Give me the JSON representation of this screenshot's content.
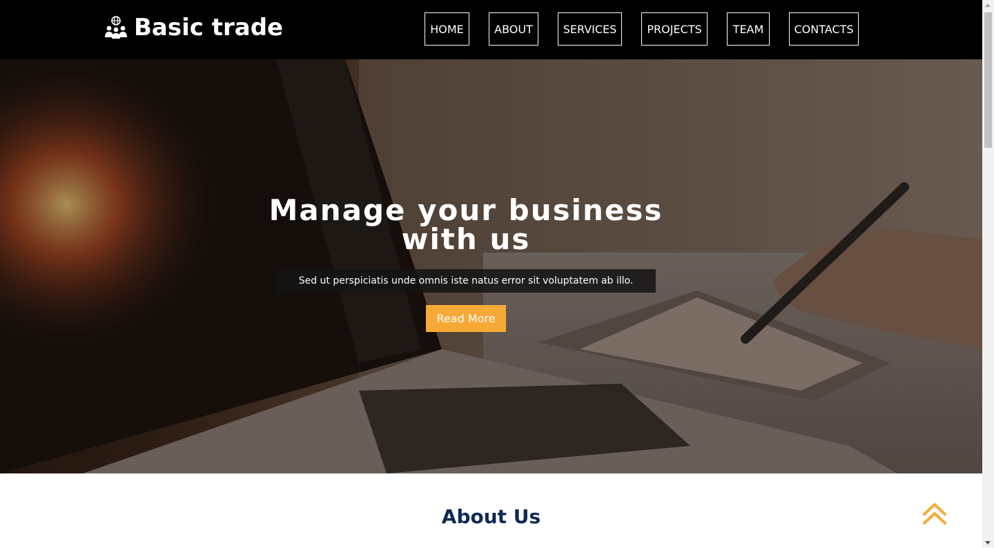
{
  "brand": {
    "name": "Basic trade",
    "icon": "team-globe-icon"
  },
  "nav": {
    "items": [
      {
        "label": "HOME"
      },
      {
        "label": "ABOUT"
      },
      {
        "label": "SERVICES"
      },
      {
        "label": "PROJECTS"
      },
      {
        "label": "TEAM"
      },
      {
        "label": "CONTACTS"
      }
    ]
  },
  "hero": {
    "title_line1": "Manage your business",
    "title_line2": "with us",
    "subtitle": "Sed ut perspiciatis unde omnis iste natus error sit voluptatem ab illo.",
    "button_label": "Read More",
    "background": "laptop-and-pen-tablet-photo"
  },
  "about": {
    "title": "About Us"
  },
  "scroll_top": {
    "icon": "double-chevron-up-icon"
  },
  "colors": {
    "header_bg": "#000000",
    "accent": "#f7a935",
    "about_title": "#0e2a55"
  }
}
